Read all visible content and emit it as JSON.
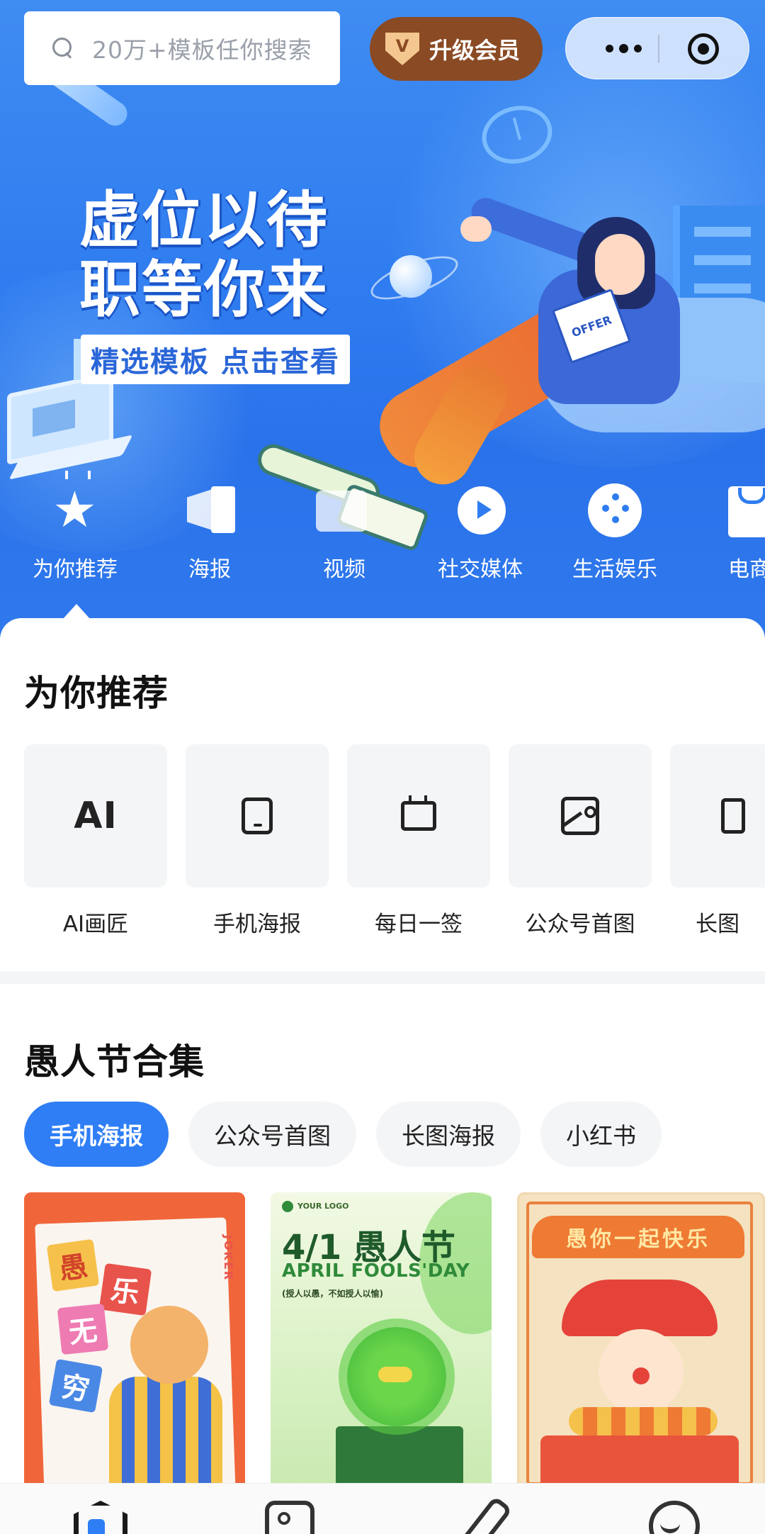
{
  "search": {
    "placeholder": "20万+模板任你搜索"
  },
  "header": {
    "vip_badge": "V",
    "vip_label": "升级会员"
  },
  "banner": {
    "title_line1": "虚位以待",
    "title_line2": "职等你来",
    "subtitle": "精选模板 点击查看",
    "card_text": "OFFER"
  },
  "categories": [
    {
      "label": "为你推荐",
      "icon": "star-icon"
    },
    {
      "label": "海报",
      "icon": "poster-icon"
    },
    {
      "label": "视频",
      "icon": "video-icon"
    },
    {
      "label": "社交媒体",
      "icon": "play-bubble-icon"
    },
    {
      "label": "生活娱乐",
      "icon": "film-reel-icon"
    },
    {
      "label": "电商",
      "icon": "shopping-bag-icon"
    }
  ],
  "recommend": {
    "title": "为你推荐",
    "tools": [
      {
        "label": "AI画匠",
        "glyph": "AI"
      },
      {
        "label": "手机海报"
      },
      {
        "label": "每日一签"
      },
      {
        "label": "公众号首图"
      },
      {
        "label": "长图"
      }
    ]
  },
  "collection": {
    "title": "愚人节合集",
    "chips": [
      "手机海报",
      "公众号首图",
      "长图海报",
      "小红书"
    ],
    "templates": [
      {
        "chars": [
          "愚",
          "乐",
          "无",
          "穷"
        ],
        "side_text": "JOKER"
      },
      {
        "logo": "YOUR LOGO",
        "title": "4/1 愚人节",
        "subtitle_en": "APRIL FOOLS'DAY",
        "tagline": "(授人以愚，不如授人以愉)"
      },
      {
        "title": "愚你一起快乐"
      }
    ]
  },
  "colors": {
    "primary": "#2f7ef5",
    "hero_blue": "#2f7cf0",
    "vip_brown": "#8a4a24"
  }
}
